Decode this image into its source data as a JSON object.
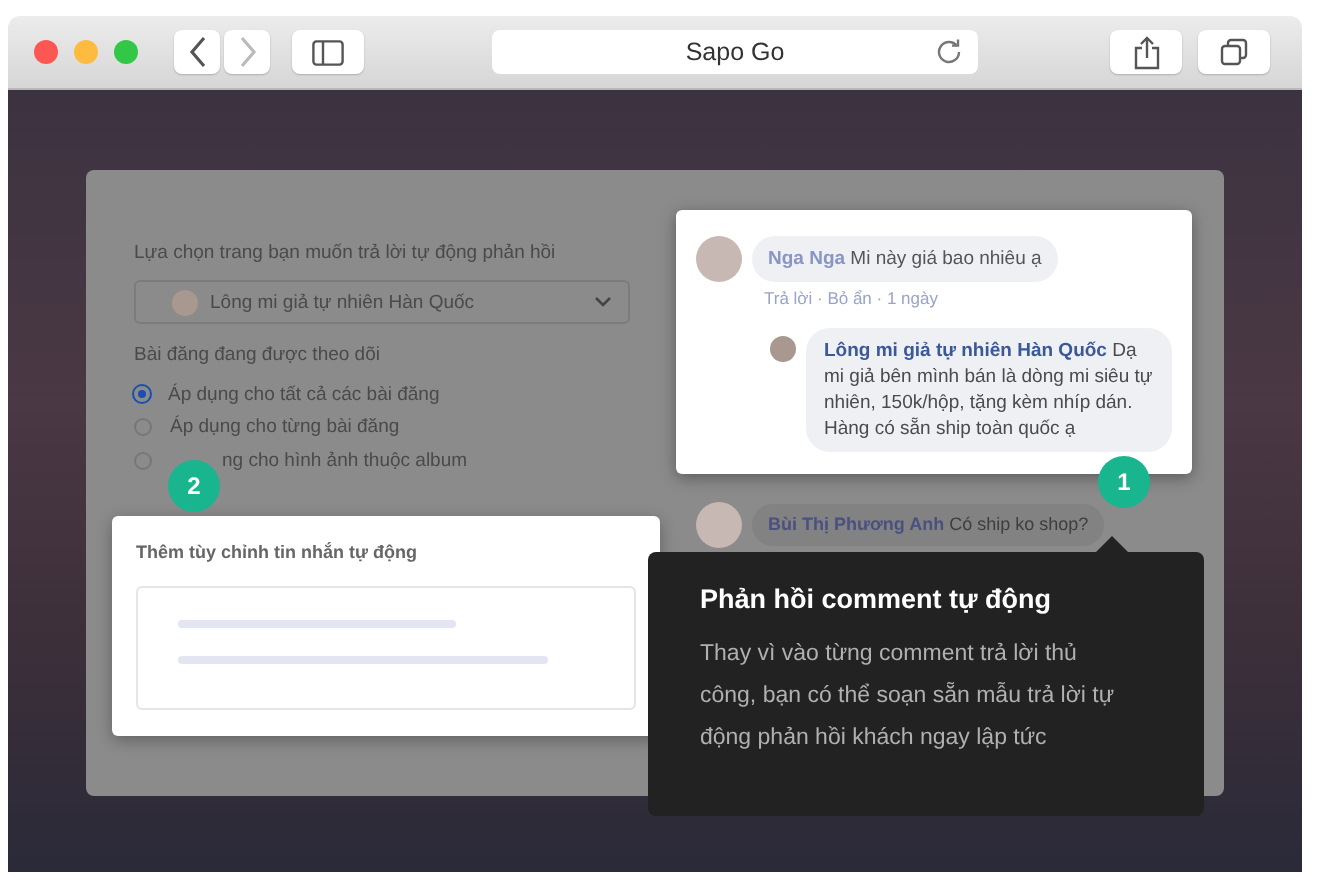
{
  "browser": {
    "address": "Sapo Go"
  },
  "form": {
    "page_label": "Lựa chọn trang bạn muốn trả lời tự động phản hồi",
    "page_select": "Lông mi giả tự nhiên Hàn Quốc",
    "posts_label": "Bài đăng đang được theo dõi",
    "options": [
      {
        "label": "Áp dụng cho tất cả các bài đăng",
        "selected": true
      },
      {
        "label": "Áp dụng cho từng bài đăng",
        "selected": false
      },
      {
        "label": "ng cho hình ảnh thuộc album",
        "selected": false
      }
    ]
  },
  "comments": [
    {
      "author": "Nga Nga",
      "text": "Mi này giá bao nhiêu ạ",
      "actions": "Trả lời · Bỏ ẩn · 1 ngày",
      "reply": {
        "author": "Lông mi giả tự nhiên Hàn Quốc",
        "text": "Dạ mi giả bên mình bán là dòng mi siêu tự nhiên, 150k/hộp, tặng kèm nhíp dán. Hàng có sẵn ship toàn quốc ạ"
      }
    },
    {
      "author": "Bùi Thị Phương Anh",
      "text": "Có ship ko shop?"
    }
  ],
  "message_card": {
    "title": "Thêm tùy chỉnh tin nhắn tự động"
  },
  "steps": [
    "2",
    "1"
  ],
  "tooltip": {
    "title": "Phản hồi comment tự động",
    "body": "Thay vì vào từng comment trả lời thủ công, bạn có thể soạn sẵn mẫu trả lời tự động phản hồi khách ngay lập tức"
  }
}
